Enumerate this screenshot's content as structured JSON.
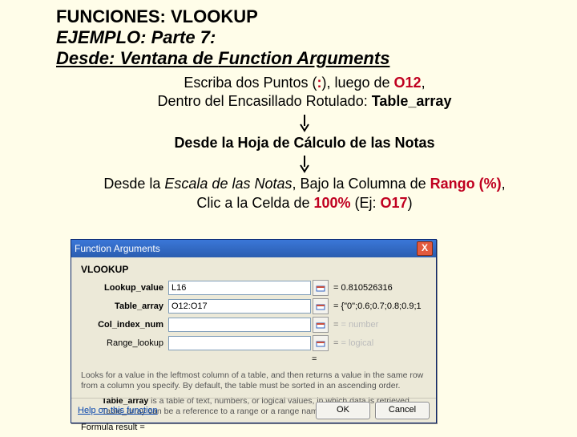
{
  "titles": {
    "l1": "FUNCIONES: VLOOKUP",
    "l2": "EJEMPLO: Parte 7:",
    "l3a": "Desde: Ventana de ",
    "l3b": "Function Arguments"
  },
  "body": {
    "l1a": "Escriba dos Puntos (",
    "l1b": ":",
    "l1c": "), luego de ",
    "l1d": "O12",
    "l1e": ",",
    "l2a": "Dentro del Encasillado Rotulado: ",
    "l2b": "Table_array",
    "l3": "Desde la Hoja de Cálculo de las Notas",
    "l4a": "Desde la ",
    "l4b": "Escala de las Notas",
    "l4c": ", Bajo la Columna de ",
    "l4d": "Rango (%)",
    "l4e": ",",
    "l5a": "Clic a  la Celda de ",
    "l5b": "100%",
    "l5c": " (Ej: ",
    "l5d": "O17",
    "l5e": ")"
  },
  "dlg": {
    "title": "Function Arguments",
    "close": "X",
    "func": "VLOOKUP",
    "labels": {
      "lookup": "Lookup_value",
      "table": "Table_array",
      "col": "Col_index_num",
      "range": "Range_lookup"
    },
    "vals": {
      "lookup": "L16",
      "table": "O12:O17",
      "col": "",
      "range": ""
    },
    "rhs": {
      "lookup": "= 0.810526316",
      "table": "= {\"0\";0.6;0.7;0.8;0.9;1",
      "col": "= number",
      "range": "= logical",
      "eq": "="
    },
    "desc1": "Looks for a value in the leftmost column of a table, and then returns a value in the same row from a column you specify. By default, the table must be sorted in an ascending order.",
    "desc2a": "Table_array",
    "desc2b": " is a table of text, numbers, or logical values, in which data is retrieved. Table_array can be a reference to a range or a range name.",
    "result": "Formula result =",
    "help": "Help on this function",
    "ok": "OK",
    "cancel": "Cancel"
  }
}
